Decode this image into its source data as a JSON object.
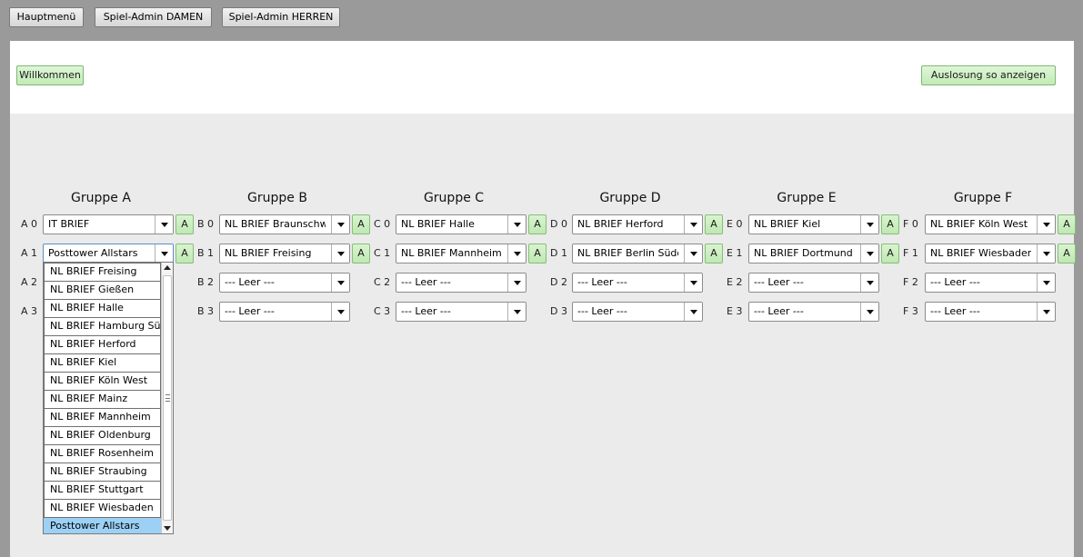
{
  "top_buttons": {
    "main_menu": "Hauptmenü",
    "admin_women": "Spiel-Admin DAMEN",
    "admin_men": "Spiel-Admin HERREN"
  },
  "panel": {
    "welcome": "Willkommen",
    "show_draw": "Auslosung so anzeigen"
  },
  "add_label": "A",
  "groups": [
    {
      "title": "Gruppe A",
      "slots": [
        {
          "label": "A 0",
          "value": "IT BRIEF"
        },
        {
          "label": "A 1",
          "value": "Posttower Allstars"
        },
        {
          "label": "A 2",
          "value": ""
        },
        {
          "label": "A 3",
          "value": ""
        }
      ]
    },
    {
      "title": "Gruppe B",
      "slots": [
        {
          "label": "B 0",
          "value": "NL BRIEF Braunschwei"
        },
        {
          "label": "B 1",
          "value": "NL BRIEF Freising"
        },
        {
          "label": "B 2",
          "value": "--- Leer ---"
        },
        {
          "label": "B 3",
          "value": "--- Leer ---"
        }
      ]
    },
    {
      "title": "Gruppe C",
      "slots": [
        {
          "label": "C 0",
          "value": "NL BRIEF Halle"
        },
        {
          "label": "C 1",
          "value": "NL BRIEF Mannheim"
        },
        {
          "label": "C 2",
          "value": "--- Leer ---"
        },
        {
          "label": "C 3",
          "value": "--- Leer ---"
        }
      ]
    },
    {
      "title": "Gruppe D",
      "slots": [
        {
          "label": "D 0",
          "value": "NL BRIEF Herford"
        },
        {
          "label": "D 1",
          "value": "NL BRIEF Berlin Südost"
        },
        {
          "label": "D 2",
          "value": "--- Leer ---"
        },
        {
          "label": "D 3",
          "value": "--- Leer ---"
        }
      ]
    },
    {
      "title": "Gruppe E",
      "slots": [
        {
          "label": "E 0",
          "value": "NL BRIEF Kiel"
        },
        {
          "label": "E 1",
          "value": "NL BRIEF Dortmund"
        },
        {
          "label": "E 2",
          "value": "--- Leer ---"
        },
        {
          "label": "E 3",
          "value": "--- Leer ---"
        }
      ]
    },
    {
      "title": "Gruppe F",
      "slots": [
        {
          "label": "F 0",
          "value": "NL BRIEF Köln West"
        },
        {
          "label": "F 1",
          "value": "NL BRIEF Wiesbaden"
        },
        {
          "label": "F 2",
          "value": "--- Leer ---"
        },
        {
          "label": "F 3",
          "value": "--- Leer ---"
        }
      ]
    }
  ],
  "dropdown": {
    "selected": "Posttower Allstars",
    "options": [
      "NL BRIEF Freising",
      "NL BRIEF Gießen",
      "NL BRIEF Halle",
      "NL BRIEF Hamburg Süd",
      "NL BRIEF Herford",
      "NL BRIEF Kiel",
      "NL BRIEF Köln West",
      "NL BRIEF Mainz",
      "NL BRIEF Mannheim",
      "NL BRIEF Oldenburg",
      "NL BRIEF Rosenheim",
      "NL BRIEF Straubing",
      "NL BRIEF Stuttgart",
      "NL BRIEF Wiesbaden",
      "Posttower Allstars"
    ]
  }
}
